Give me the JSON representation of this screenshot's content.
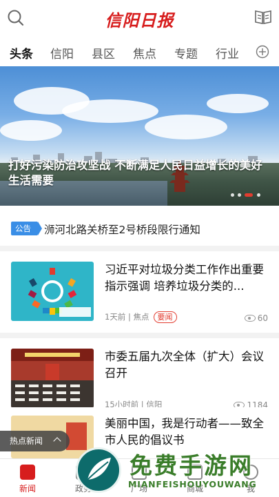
{
  "header": {
    "logo_text": "信阳日报",
    "search_icon": "search-icon",
    "read_icon": "book-icon"
  },
  "tabs": [
    {
      "label": "头条",
      "active": true
    },
    {
      "label": "信阳",
      "active": false
    },
    {
      "label": "县区",
      "active": false
    },
    {
      "label": "焦点",
      "active": false
    },
    {
      "label": "专题",
      "active": false
    },
    {
      "label": "行业",
      "active": false
    }
  ],
  "banner": {
    "title": "打好污染防治攻坚战 不断满足人民日益增长的美好生活需要",
    "slide_count": 4,
    "active_slide": 3
  },
  "notice": {
    "badge": "公告",
    "text": "浉河北路关桥至2号桥段限行通知"
  },
  "news": [
    {
      "headline": "习近平对垃圾分类工作作出重要指示强调 培养垃圾分类的...",
      "time": "1天前",
      "channel": "焦点",
      "tag": "要闻",
      "views": "60"
    },
    {
      "headline": "市委五届九次全体（扩大）会议召开",
      "time": "15小时前",
      "channel": "信阳",
      "tag": "",
      "views": "1184"
    },
    {
      "headline": "美丽中国，我是行动者——致全市人民的倡议书",
      "time": "",
      "channel": "",
      "tag": "",
      "views": ""
    }
  ],
  "hot_news": "热点新闻",
  "bottom_nav": [
    {
      "label": "新闻",
      "active": true
    },
    {
      "label": "政务",
      "active": false
    },
    {
      "label": "广场",
      "active": false
    },
    {
      "label": "商城",
      "active": false
    },
    {
      "label": "我",
      "active": false
    }
  ],
  "watermark": {
    "title": "免费手游网",
    "subtitle": "MIANFEISHOUYOUWANG"
  },
  "colors": {
    "brand_red": "#d71d1d",
    "notice_blue": "#3a8ee6"
  }
}
